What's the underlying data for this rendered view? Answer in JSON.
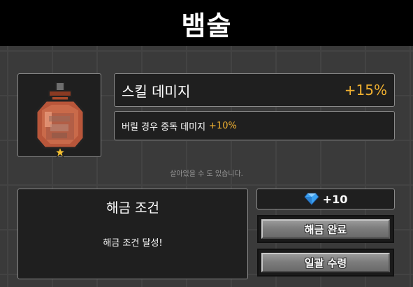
{
  "header": {
    "title": "뱀술"
  },
  "item": {
    "icon": "snake-wine-bottle-icon",
    "badge_icon": "star-icon"
  },
  "skill": {
    "name": "스킬 데미지",
    "value": "+15%",
    "sub_label": "버릴 경우 중독 데미지",
    "sub_value": "+10%"
  },
  "hint": "살아있을 수 도 있습니다.",
  "unlock": {
    "title": "해금 조건",
    "status": "해금 조건 달성!"
  },
  "cost": {
    "icon": "diamond-icon",
    "amount": "+10"
  },
  "buttons": {
    "complete": "해금 완료",
    "collect_all": "일괄 수령"
  },
  "colors": {
    "accent": "#f0b030",
    "topbar": "#000000",
    "panel": "#1f1f1f"
  }
}
